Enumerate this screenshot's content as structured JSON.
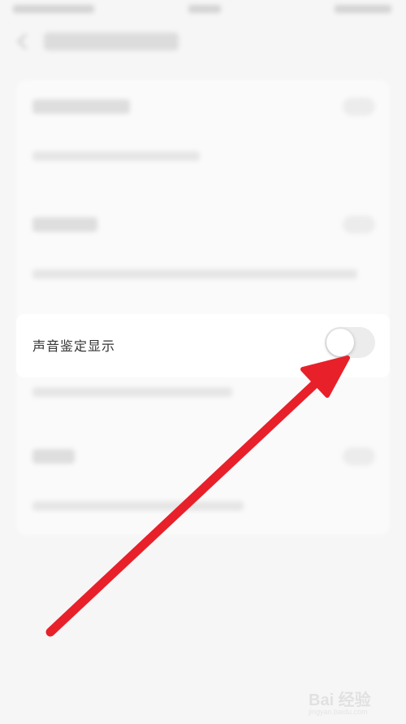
{
  "focused_setting": {
    "label": "声音鉴定显示",
    "enabled": false
  },
  "colors": {
    "arrow": "#e8202a",
    "toggle_track_off": "#ececec",
    "background": "#f6f6f6"
  },
  "watermark": {
    "text": "Bai 经验",
    "url": "jingyan.baidu.com"
  }
}
